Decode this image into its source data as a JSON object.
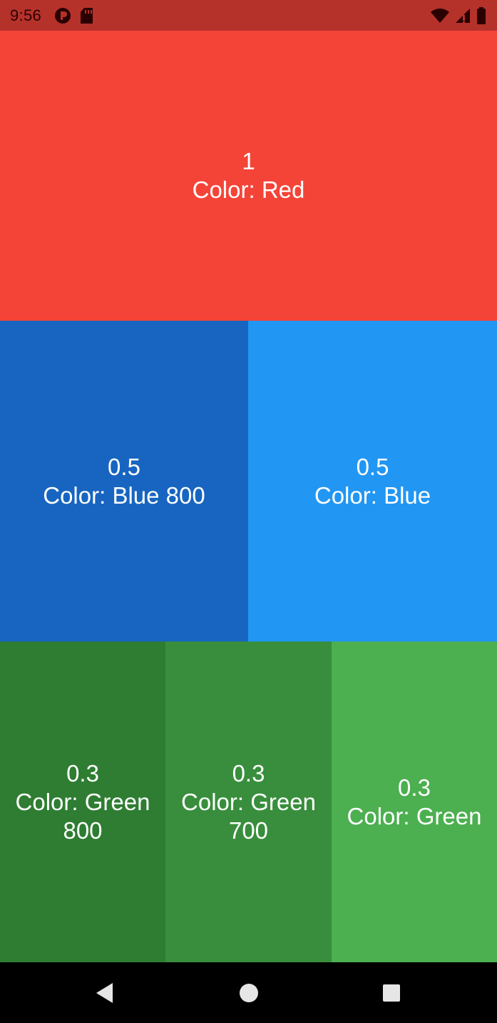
{
  "status_bar": {
    "time": "9:56",
    "background": "#B5322B",
    "icons": [
      "vpn-icon",
      "sd-card-icon",
      "wifi-icon",
      "signal-icon",
      "battery-icon"
    ]
  },
  "tiles": [
    {
      "value": "1",
      "label": "Color: Red",
      "color": "#F44438"
    },
    {
      "value": "0.5",
      "label": "Color: Blue 800",
      "color": "#1765C0"
    },
    {
      "value": "0.5",
      "label": "Color: Blue",
      "color": "#2196F3"
    },
    {
      "value": "0.3",
      "label": "Color: Green 800",
      "color": "#2E7D32"
    },
    {
      "value": "0.3",
      "label": "Color: Green 700",
      "color": "#388E3C"
    },
    {
      "value": "0.3",
      "label": "Color: Green",
      "color": "#4CAF50"
    }
  ],
  "nav_bar": {
    "icons": [
      "back-icon",
      "home-icon",
      "recents-icon"
    ]
  }
}
